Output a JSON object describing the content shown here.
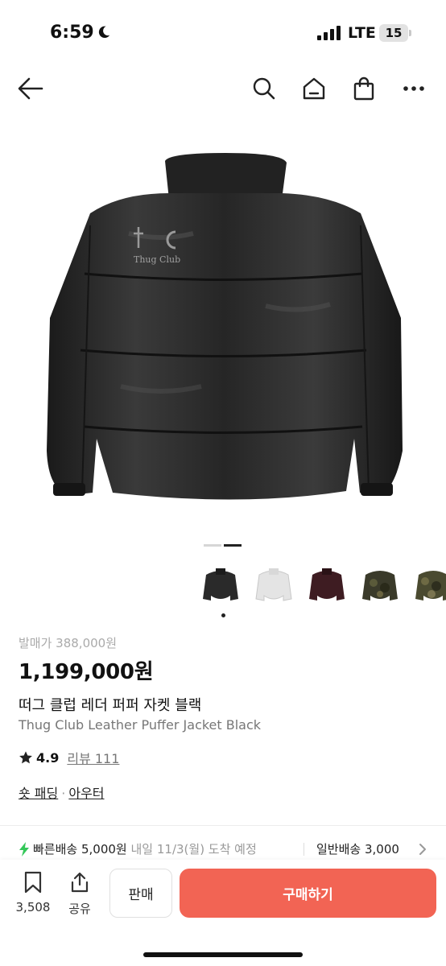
{
  "status_bar": {
    "time": "6:59",
    "network": "LTE",
    "battery": "15"
  },
  "nav": {
    "icons": [
      "back-arrow-icon",
      "search-icon",
      "home-icon",
      "shopping-bag-icon",
      "more-icon"
    ]
  },
  "product": {
    "hero_logo_text": "Thug Club",
    "image_index": 2,
    "image_count": 2,
    "thumbnails": [
      "black-jacket",
      "white-jacket",
      "burgundy-jacket",
      "olive-camo-jacket",
      "camo-jacket"
    ],
    "selected_thumbnail": 0,
    "original_price_label": "발매가 388,000원",
    "price": "1,199,000원",
    "title_ko": "떠그 클럽 레더 퍼퍼 자켓 블랙",
    "title_en": "Thug Club Leather Puffer Jacket Black",
    "rating": "4.9",
    "review_label": "리뷰 111",
    "category": {
      "sub": "숏 패딩",
      "separator": "·",
      "main": "아우터"
    }
  },
  "shipping": {
    "fast": "빠른배송 5,000원",
    "fast_date": " 내일 11/3(월) 도착 예정",
    "normal": "일반배송 3,000"
  },
  "bottom_bar": {
    "wish_count": "3,508",
    "share_label": "공유",
    "sell_label": "판매",
    "buy_label": "구매하기"
  },
  "colors": {
    "accent": "#f26454",
    "fast_ship": "#34c759"
  }
}
